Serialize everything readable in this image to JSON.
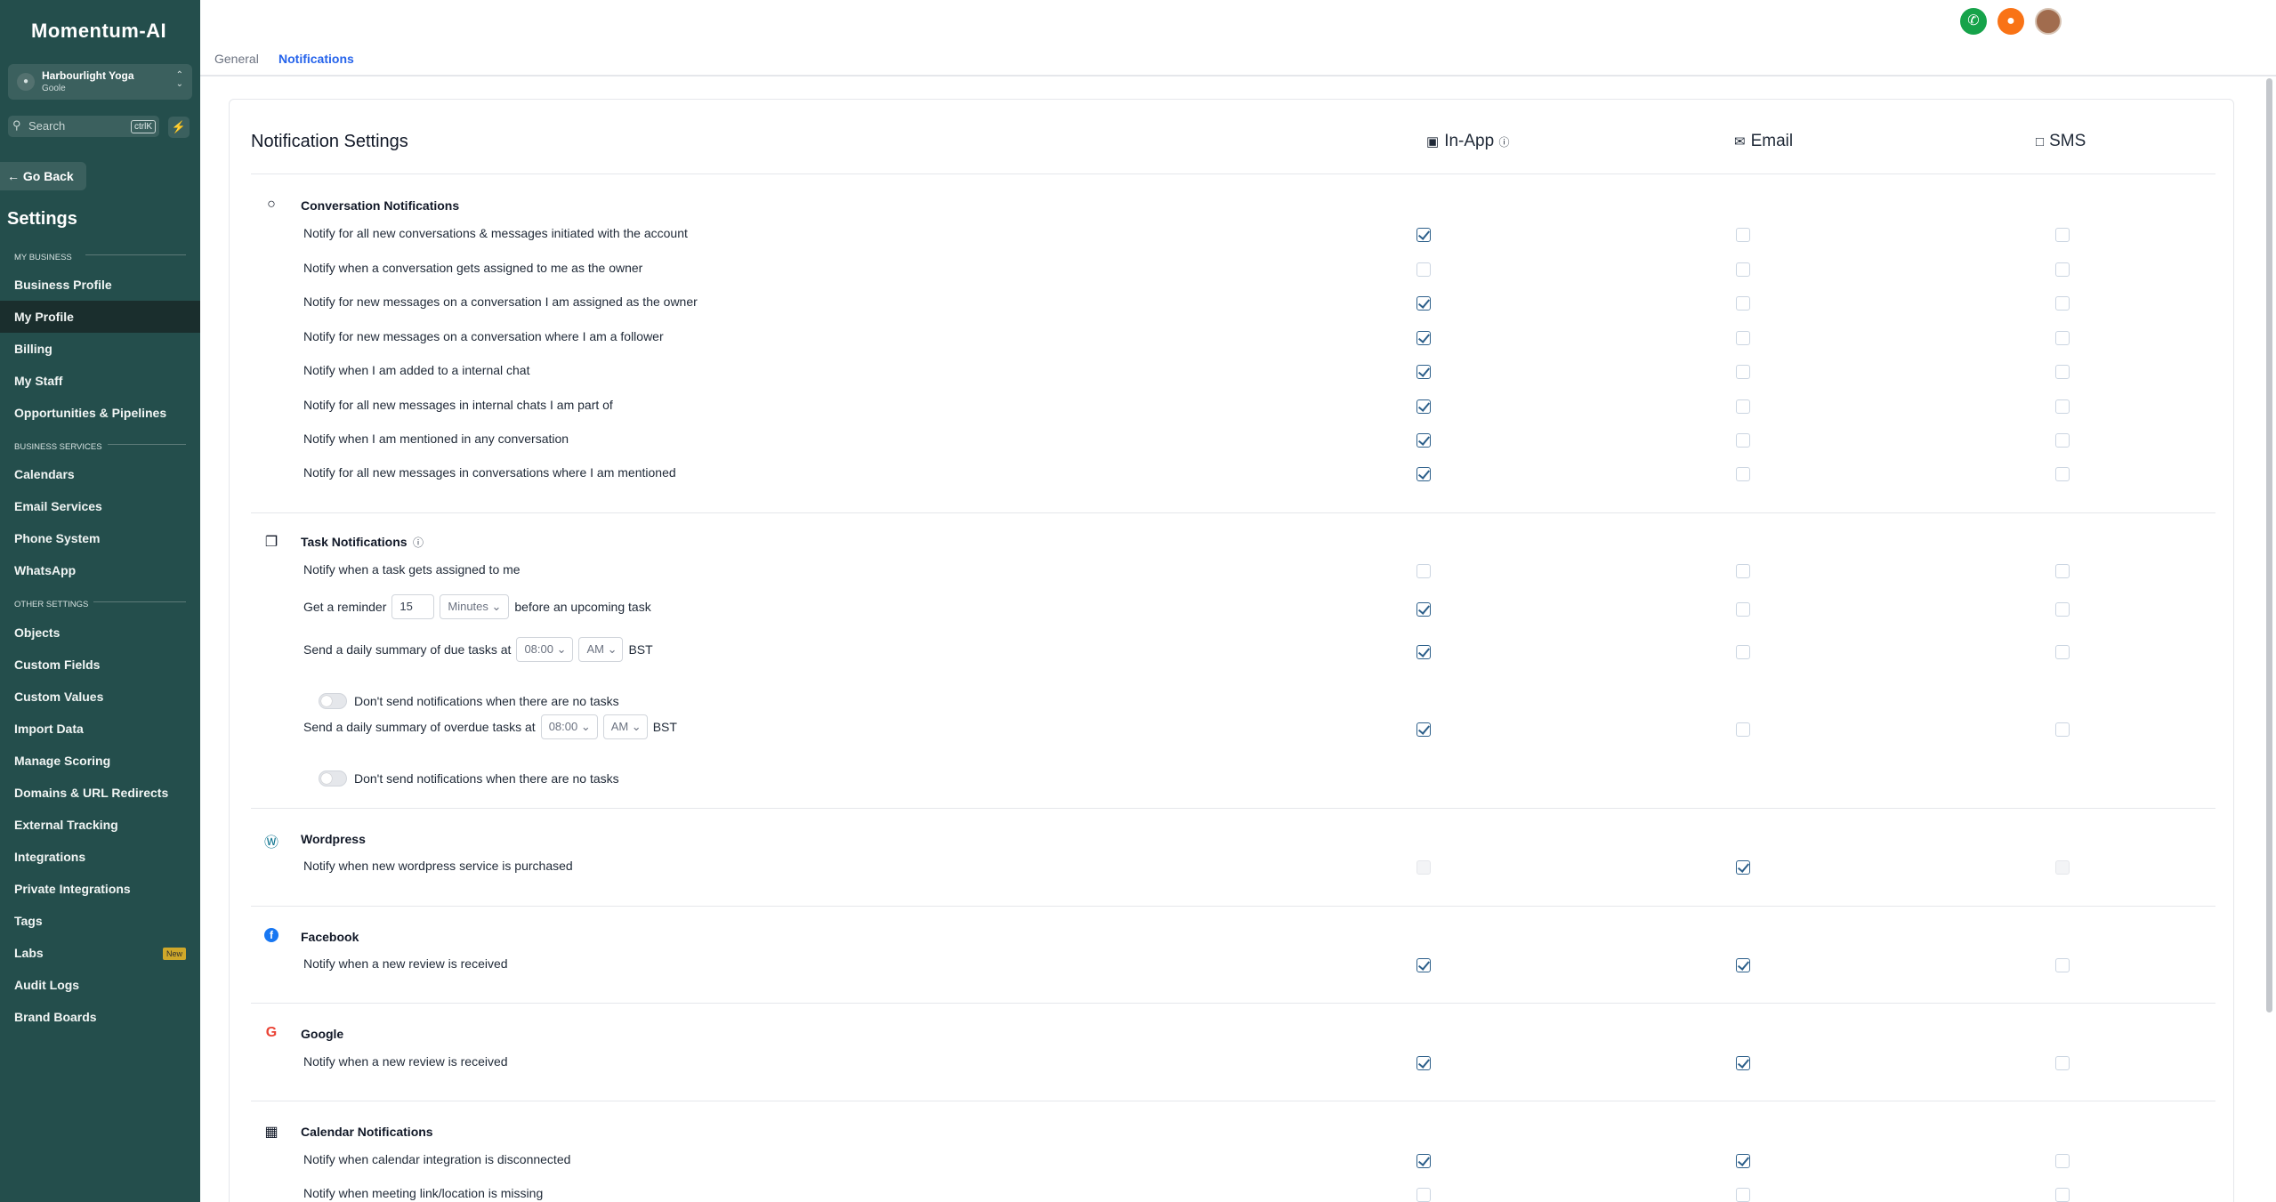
{
  "app": {
    "logo": "Momentum-AI"
  },
  "account": {
    "name": "Harbourlight Yoga",
    "location": "Goole",
    "icon": "lock-icon"
  },
  "search": {
    "placeholder": "Search",
    "shortcut": "ctrlK"
  },
  "sidebar": {
    "go_back": "Go Back",
    "title": "Settings",
    "sections": {
      "my_business": "MY BUSINESS",
      "business_services": "BUSINESS SERVICES",
      "other_settings": "OTHER SETTINGS"
    },
    "items": [
      {
        "label": "Business Profile"
      },
      {
        "label": "My Profile",
        "active": true
      },
      {
        "label": "Billing"
      },
      {
        "label": "My Staff"
      },
      {
        "label": "Opportunities & Pipelines"
      },
      {
        "label": "Calendars"
      },
      {
        "label": "Email Services"
      },
      {
        "label": "Phone System"
      },
      {
        "label": "WhatsApp"
      },
      {
        "label": "Objects"
      },
      {
        "label": "Custom Fields"
      },
      {
        "label": "Custom Values"
      },
      {
        "label": "Import Data"
      },
      {
        "label": "Manage Scoring"
      },
      {
        "label": "Domains & URL Redirects"
      },
      {
        "label": "External Tracking"
      },
      {
        "label": "Integrations"
      },
      {
        "label": "Private Integrations"
      },
      {
        "label": "Tags"
      },
      {
        "label": "Labs",
        "badge": "New"
      },
      {
        "label": "Audit Logs"
      },
      {
        "label": "Brand Boards"
      }
    ]
  },
  "tabs": {
    "general": "General",
    "notifications": "Notifications"
  },
  "page": {
    "title": "Notification Settings",
    "columns": {
      "in_app": "In-App",
      "email": "Email",
      "sms": "SMS"
    }
  },
  "groups": {
    "conversation": {
      "title": "Conversation Notifications",
      "rows": [
        {
          "label": "Notify for all new conversations & messages initiated with the account",
          "in_app": true,
          "email": false,
          "sms": false
        },
        {
          "label": "Notify when a conversation gets assigned to me as the owner",
          "in_app": false,
          "email": false,
          "sms": false
        },
        {
          "label": "Notify for new messages on a conversation I am assigned as the owner",
          "in_app": true,
          "email": false,
          "sms": false
        },
        {
          "label": "Notify for new messages on a conversation where I am a follower",
          "in_app": true,
          "email": false,
          "sms": false
        },
        {
          "label": "Notify when I am added to a internal chat",
          "in_app": true,
          "email": false,
          "sms": false
        },
        {
          "label": "Notify for all new messages in internal chats I am part of",
          "in_app": true,
          "email": false,
          "sms": false
        },
        {
          "label": "Notify when I am mentioned in any conversation",
          "in_app": true,
          "email": false,
          "sms": false
        },
        {
          "label": "Notify for all new messages in conversations where I am mentioned",
          "in_app": true,
          "email": false,
          "sms": false
        }
      ]
    },
    "task": {
      "title": "Task Notifications",
      "assigned": {
        "label": "Notify when a task gets assigned to me",
        "in_app": false,
        "email": false,
        "sms": false
      },
      "reminder": {
        "prefix": "Get a reminder",
        "value": "15",
        "unit": "Minutes",
        "suffix": "before an upcoming task",
        "in_app": true,
        "email": false,
        "sms": false
      },
      "due_summary": {
        "prefix": "Send a daily summary of due tasks at",
        "time": "08:00",
        "ampm": "AM",
        "tz": "BST",
        "in_app": true,
        "email": false,
        "sms": false
      },
      "due_toggle": "Don't send notifications when there are no tasks",
      "overdue_summary": {
        "prefix": "Send a daily summary of overdue tasks at",
        "time": "08:00",
        "ampm": "AM",
        "tz": "BST",
        "in_app": true,
        "email": false,
        "sms": false
      },
      "overdue_toggle": "Don't send notifications when there are no tasks"
    },
    "wordpress": {
      "title": "Wordpress",
      "rows": [
        {
          "label": "Notify when new wordpress service is purchased",
          "in_app": false,
          "email": true,
          "sms": false
        }
      ]
    },
    "facebook": {
      "title": "Facebook",
      "rows": [
        {
          "label": "Notify when a new review is received",
          "in_app": true,
          "email": true,
          "sms": false
        }
      ]
    },
    "google": {
      "title": "Google",
      "rows": [
        {
          "label": "Notify when a new review is received",
          "in_app": true,
          "email": true,
          "sms": false
        }
      ]
    },
    "calendar": {
      "title": "Calendar Notifications",
      "rows": [
        {
          "label": "Notify when calendar integration is disconnected",
          "in_app": true,
          "email": true,
          "sms": false
        },
        {
          "label": "Notify when meeting link/location is missing",
          "in_app": false,
          "email": false,
          "sms": false
        }
      ]
    }
  },
  "colors": {
    "sidebar": "#244e4c",
    "accent": "#2563eb",
    "checkbox": "#2c5f8a"
  }
}
